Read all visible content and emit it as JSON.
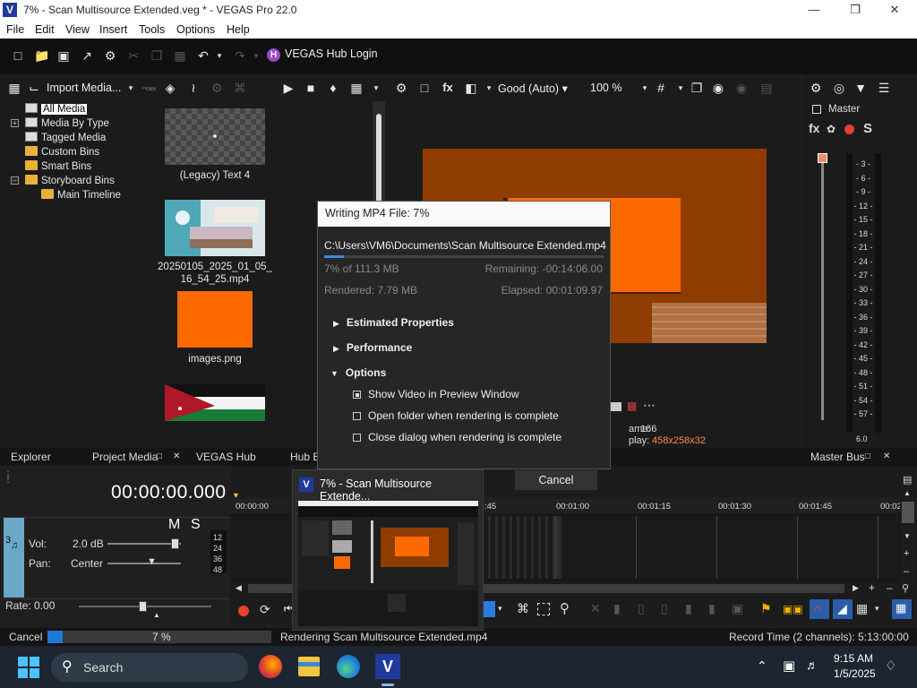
{
  "window": {
    "title": "7% - Scan Multisource Extended.veg * - VEGAS Pro 22.0",
    "logo_letter": "V"
  },
  "menu": [
    "File",
    "Edit",
    "View",
    "Insert",
    "Tools",
    "Options",
    "Help"
  ],
  "toolbar": {
    "hub_login": "VEGAS Hub Login"
  },
  "explorer": {
    "import_label": "Import Media...",
    "tree": [
      "All Media",
      "Media By Type",
      "Tagged Media",
      "Custom Bins",
      "Smart Bins",
      "Storyboard Bins",
      "Main Timeline"
    ]
  },
  "media": [
    {
      "label": "(Legacy) Text 4"
    },
    {
      "label": "20250105_2025_01_05_\n16_54_25.mp4"
    },
    {
      "label": "images.png"
    }
  ],
  "preview": {
    "quality": "Good (Auto)",
    "zoom": "100 %",
    "frame_label": "ame:",
    "frame_value": "166",
    "display_label": "play:",
    "display_value": "458x258x32"
  },
  "master": {
    "title": "Master",
    "solo": "S",
    "meter_labels": [
      "3",
      "6",
      "9",
      "12",
      "15",
      "18",
      "21",
      "24",
      "27",
      "30",
      "33",
      "36",
      "39",
      "42",
      "45",
      "48",
      "51",
      "54",
      "57"
    ],
    "meter_bottom": "6.0"
  },
  "tabs": [
    "Explorer",
    "Project Media",
    "VEGAS Hub",
    "Hub E",
    "Master Bus"
  ],
  "track": {
    "timecode": "00:00:00.000",
    "mute": "M",
    "solo": "S",
    "number": "3",
    "vol_label": "Vol:",
    "vol_value": "2.0 dB",
    "pan_label": "Pan:",
    "pan_value": "Center",
    "rate_label": "Rate: 0.00",
    "mini_meter": [
      "12",
      "24",
      "36",
      "48"
    ]
  },
  "timeline": {
    "ticks": [
      "00:00:00",
      ":45",
      "00:01:00",
      "00:01:15",
      "00:01:30",
      "00:01:45",
      "00:02"
    ]
  },
  "status": {
    "cancel": "Cancel",
    "percent": "7 %",
    "progress": 0.07,
    "rendering": "Rendering Scan Multisource Extended.mp4",
    "record_time": "Record Time (2 channels): 5:13:00:00"
  },
  "dialog": {
    "title": "Writing MP4 File: 7%",
    "path": "C:\\Users\\VM6\\Documents\\Scan Multisource Extended.mp4",
    "progress": 0.07,
    "size_text": "7% of 111.3 MB",
    "remaining": "Remaining: -00:14:06.00",
    "rendered": "Rendered: 7.79 MB",
    "elapsed": "Elapsed: 00:01:09.97",
    "sections": [
      "Estimated Properties",
      "Performance",
      "Options"
    ],
    "options": [
      {
        "label": "Show Video in Preview Window",
        "checked": true
      },
      {
        "label": "Open folder when rendering is complete",
        "checked": false
      },
      {
        "label": "Close dialog when rendering is complete",
        "checked": false
      }
    ],
    "cancel": "Cancel"
  },
  "taskbar_popup": {
    "title": "7% - Scan Multisource Extende..."
  },
  "taskbar": {
    "search": "Search",
    "time": "9:15 AM",
    "date": "1/5/2025"
  },
  "colors": {
    "accent": "#ff6a00",
    "brand": "#1f3a9c",
    "progress": "#1e7ad8"
  }
}
